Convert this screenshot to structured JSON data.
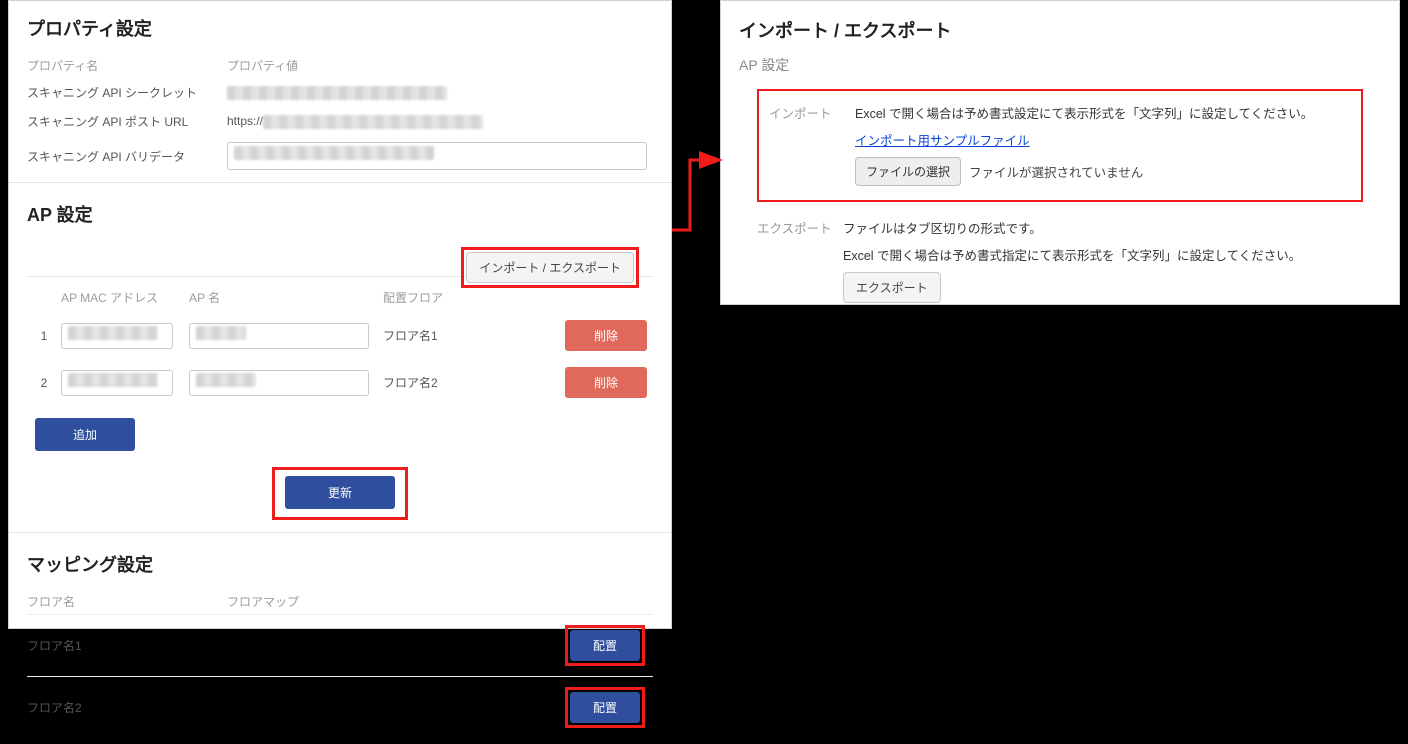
{
  "left": {
    "property": {
      "title": "プロパティ設定",
      "head_name": "プロパティ名",
      "head_value": "プロパティ値",
      "rows": [
        {
          "name": "スキャニング API シークレット"
        },
        {
          "name": "スキャニング API ポスト URL",
          "prefix": "https://"
        },
        {
          "name": "スキャニング API バリデータ"
        }
      ]
    },
    "ap": {
      "title": "AP 設定",
      "import_export_btn": "インポート / エクスポート",
      "head_mac": "AP MAC アドレス",
      "head_apname": "AP 名",
      "head_floor": "配置フロア",
      "rows": [
        {
          "idx": "1",
          "floor": "フロア名1",
          "delete": "削除"
        },
        {
          "idx": "2",
          "floor": "フロア名2",
          "delete": "削除"
        }
      ],
      "add_btn": "追加",
      "update_btn": "更新"
    },
    "mapping": {
      "title": "マッピング設定",
      "head_floor": "フロア名",
      "head_map": "フロアマップ",
      "rows": [
        {
          "floor": "フロア名1",
          "place": "配置"
        },
        {
          "floor": "フロア名2",
          "place": "配置"
        }
      ]
    }
  },
  "right": {
    "title": "インポート / エクスポート",
    "subtitle": "AP 設定",
    "import": {
      "label": "インポート",
      "note": "Excel で開く場合は予め書式設定にて表示形式を「文字列」に設定してください。",
      "sample_link": "インポート用サンプルファイル",
      "choose_btn": "ファイルの選択",
      "no_file": "ファイルが選択されていません"
    },
    "export": {
      "label": "エクスポート",
      "note1": "ファイルはタブ区切りの形式です。",
      "note2": "Excel で開く場合は予め書式指定にて表示形式を「文字列」に設定してください。",
      "btn": "エクスポート"
    }
  }
}
